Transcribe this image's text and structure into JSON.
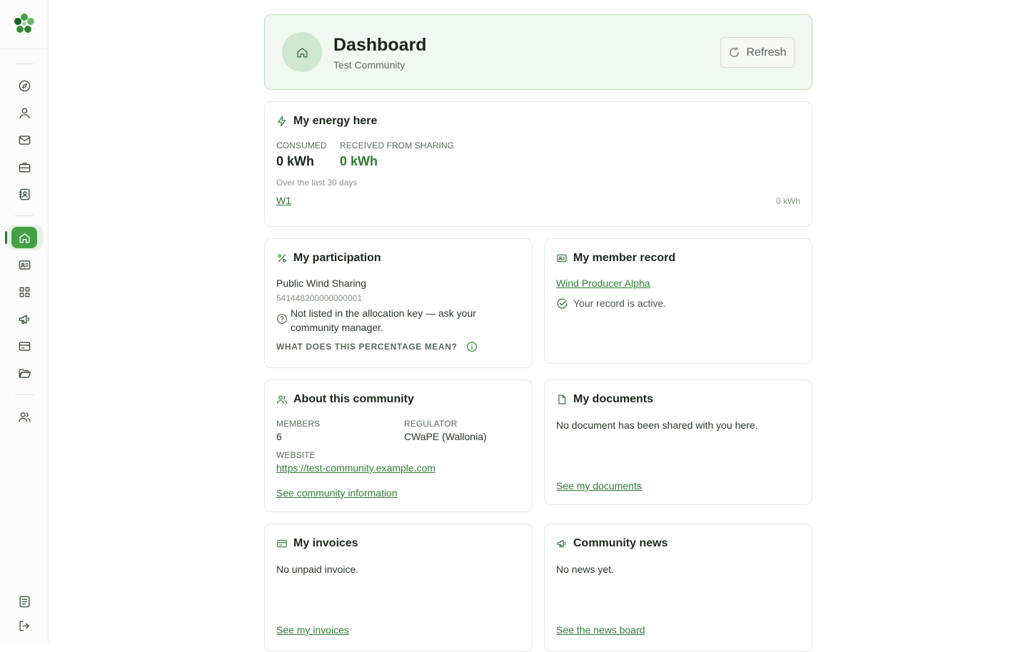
{
  "header": {
    "title": "Dashboard",
    "subtitle": "Test Community",
    "refresh_label": "Refresh"
  },
  "energy": {
    "title": "My energy here",
    "consumed_label": "CONSUMED",
    "consumed_value": "0 kWh",
    "received_label": "RECEIVED FROM SHARING",
    "received_value": "0 kWh",
    "period": "Over the last 30 days",
    "meter_link": "W1",
    "meter_value": "0 kWh"
  },
  "participation": {
    "title": "My participation",
    "name": "Public Wind Sharing",
    "ean": "541448200000000001",
    "notice": "Not listed in the allocation key — ask your community manager.",
    "help_label": "WHAT DOES THIS PERCENTAGE MEAN?"
  },
  "member_record": {
    "title": "My member record",
    "link": "Wind Producer Alpha",
    "status": "Your record is active."
  },
  "community": {
    "title": "About this community",
    "members_label": "MEMBERS",
    "members_value": "6",
    "regulator_label": "REGULATOR",
    "regulator_value": "CWaPE (Wallonia)",
    "website_label": "WEBSITE",
    "website_value": "https://test-community.example.com",
    "info_link": "See community information"
  },
  "documents": {
    "title": "My documents",
    "empty": "No document has been shared with you here.",
    "link": "See my documents"
  },
  "invoices": {
    "title": "My invoices",
    "empty": "No unpaid invoice.",
    "link": "See my invoices"
  },
  "news": {
    "title": "Community news",
    "empty": "No news yet.",
    "link": "See the news board"
  },
  "colors": {
    "accent": "#2e7d32",
    "accent_light": "#f1f8f1",
    "active_nav": "#43a047"
  }
}
